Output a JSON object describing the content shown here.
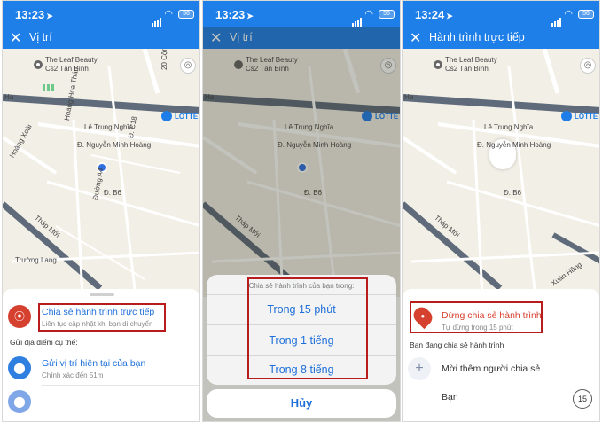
{
  "panel1": {
    "status": {
      "time": "13:23",
      "battery": "56"
    },
    "nav": {
      "title": "Vị trí"
    },
    "map": {
      "place_name": "The Leaf Beauty",
      "place_sub": "Cs2 Tân Bình",
      "road1": "20 Cộng Hòa",
      "lotte": "LOTTE",
      "street1": "Lê Trung Nghĩa",
      "street2": "Đ. Nguyễn Minh Hoàng",
      "street3": "Hoàng Hoa Thám",
      "street4": "Đ. C18",
      "street5": "Đường A4",
      "street6": "Đ. B6",
      "street7": "Hoàng Xoài",
      "street8": "Tháp Mới",
      "street9": "Trường Lang",
      "ha_label": "Ha"
    },
    "sheet": {
      "live_title": "Chia sẻ hành trình trực tiếp",
      "live_sub": "Liên tục cập nhật khi bạn di chuyển",
      "section_label": "Gửi địa điểm cụ thể:",
      "current_title": "Gửi vị trí hiện tại của bạn",
      "current_sub": "Chính xác đến 51m"
    }
  },
  "panel2": {
    "status": {
      "time": "13:23",
      "battery": "56"
    },
    "nav": {
      "title": "Vị trí"
    },
    "action_sheet": {
      "header": "Chia sẻ hành trình của bạn trong:",
      "options": [
        "Trong 15 phút",
        "Trong 1 tiếng",
        "Trong 8 tiếng"
      ],
      "cancel": "Hủy"
    }
  },
  "panel3": {
    "status": {
      "time": "13:24",
      "battery": "56"
    },
    "nav": {
      "title": "Hành trình trực tiếp"
    },
    "map": {
      "xuan_hong": "Xuân Hồng"
    },
    "sheet": {
      "stop_title": "Dừng chia sẻ hành trình",
      "stop_sub": "Tự dừng trong 15 phút",
      "section_label": "Bạn đang chia sẻ hành trình",
      "invite_label": "Mời thêm người chia sẻ",
      "you_label": "Bạn",
      "count": "15"
    }
  },
  "colors": {
    "accent": "#1f7fe8",
    "link": "#1e6fd9",
    "highlight_box": "#b91c1c",
    "live_icon": "#d6402f",
    "stop_text": "#d6402f",
    "road_major": "#5f6b7a",
    "road_minor": "#ffffff",
    "map_bg": "#f2efe6"
  }
}
